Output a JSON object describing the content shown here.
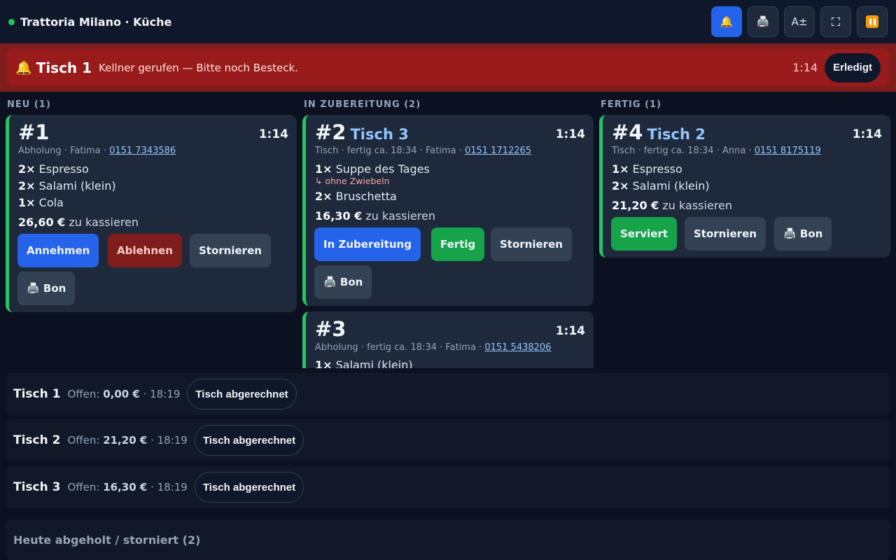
{
  "header": {
    "title": "Trattoria Milano · Küche",
    "tools": [
      {
        "name": "bell-icon",
        "glyph": "🔔"
      },
      {
        "name": "printer-icon",
        "glyph": "🖨️"
      },
      {
        "name": "font-size-icon",
        "glyph": "A±"
      }
    ]
  },
  "alert": {
    "bell": "🔔",
    "table": "Tisch 1",
    "message": "Kellner gerufen — Bitte noch Besteck.",
    "time": "1:14",
    "done_label": "Erledigt"
  },
  "columns": {
    "new": "NEU (1)",
    "prep": "IN ZUBEREITUNG (2)",
    "ready": "FERTIG (1)"
  },
  "orders": {
    "o1": {
      "number": "#1",
      "table": "",
      "time": "1:14",
      "meta": "Abholung · Fatima · ",
      "phone": "0151 7343586",
      "items": [
        {
          "qty": "2×",
          "name": "Espresso"
        },
        {
          "qty": "2×",
          "name": "Salami (klein)"
        },
        {
          "qty": "1×",
          "name": "Cola"
        }
      ],
      "total": "26,60 €",
      "total_suffix": "zu kassieren",
      "buttons": {
        "accept": "Annehmen",
        "reject": "Ablehnen",
        "cancel": "Stornieren",
        "bon": "🖨️ Bon"
      }
    },
    "o2": {
      "number": "#2",
      "table": "Tisch 3",
      "time": "1:14",
      "meta": "Tisch · fertig ca. 18:34 · Fatima · ",
      "phone": "0151 1712265",
      "items": [
        {
          "qty": "1×",
          "name": "Suppe des Tages",
          "note": "↳ ohne Zwiebeln"
        },
        {
          "qty": "2×",
          "name": "Bruschetta"
        }
      ],
      "total": "16,30 €",
      "total_suffix": "zu kassieren",
      "buttons": {
        "prep": "In Zubereitung",
        "ready": "Fertig",
        "cancel": "Stornieren",
        "bon": "🖨️ Bon"
      }
    },
    "o3": {
      "number": "#3",
      "table": "",
      "time": "1:14",
      "meta": "Abholung · fertig ca. 18:34 · Fatima · ",
      "phone": "0151 5438206",
      "items": [
        {
          "qty": "1×",
          "name": "Salami (klein)"
        }
      ]
    },
    "o4": {
      "number": "#4",
      "table": "Tisch 2",
      "time": "1:14",
      "meta": "Tisch · fertig ca. 18:34 · Anna · ",
      "phone": "0151 8175119",
      "items": [
        {
          "qty": "1×",
          "name": "Espresso"
        },
        {
          "qty": "2×",
          "name": "Salami (klein)"
        }
      ],
      "total": "21,20 €",
      "total_suffix": "zu kassieren",
      "buttons": {
        "served": "Serviert",
        "cancel": "Stornieren",
        "bon": "🖨️ Bon"
      }
    }
  },
  "tables": [
    {
      "name": "Tisch 1",
      "open_label": "Offen:",
      "amount": "0,00 €",
      "time": "· 18:19",
      "action": "Tisch abgerechnet"
    },
    {
      "name": "Tisch 2",
      "open_label": "Offen:",
      "amount": "21,20 €",
      "time": "· 18:19",
      "action": "Tisch abgerechnet"
    },
    {
      "name": "Tisch 3",
      "open_label": "Offen:",
      "amount": "16,30 €",
      "time": "· 18:19",
      "action": "Tisch abgerechnet"
    }
  ],
  "history_label": "Heute abgeholt / storniert (2)"
}
